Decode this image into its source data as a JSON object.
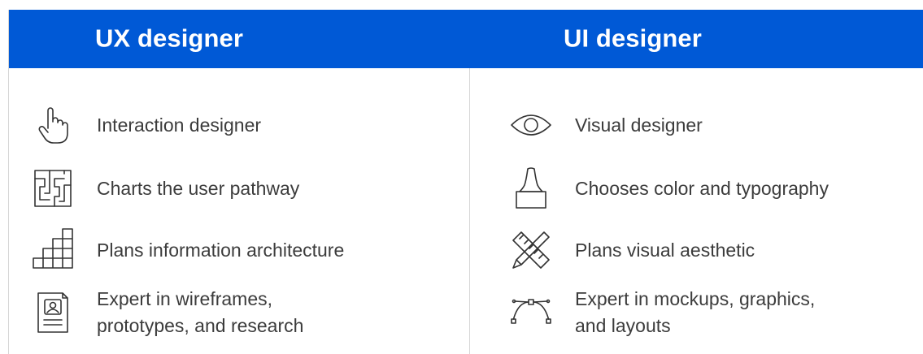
{
  "header": {
    "ux_title": "UX designer",
    "ui_title": "UI designer"
  },
  "ux_items": [
    {
      "icon": "pointing-hand-icon",
      "label": "Interaction designer"
    },
    {
      "icon": "maze-icon",
      "label": "Charts the user pathway"
    },
    {
      "icon": "blocks-staircase-icon",
      "label": "Plans information architecture"
    },
    {
      "icon": "document-profile-icon",
      "label": "Expert in wireframes,\nprototypes, and research"
    }
  ],
  "ui_items": [
    {
      "icon": "eye-icon",
      "label": "Visual designer"
    },
    {
      "icon": "paintbrush-icon",
      "label": "Chooses color and typography"
    },
    {
      "icon": "ruler-pencil-icon",
      "label": "Plans visual aesthetic"
    },
    {
      "icon": "bezier-curve-icon",
      "label": "Expert in mockups, graphics,\nand layouts"
    }
  ],
  "colors": {
    "header_bg": "#0059d6",
    "header_text": "#ffffff",
    "body_text": "#3c3c3c",
    "divider": "#d6d6d6"
  }
}
